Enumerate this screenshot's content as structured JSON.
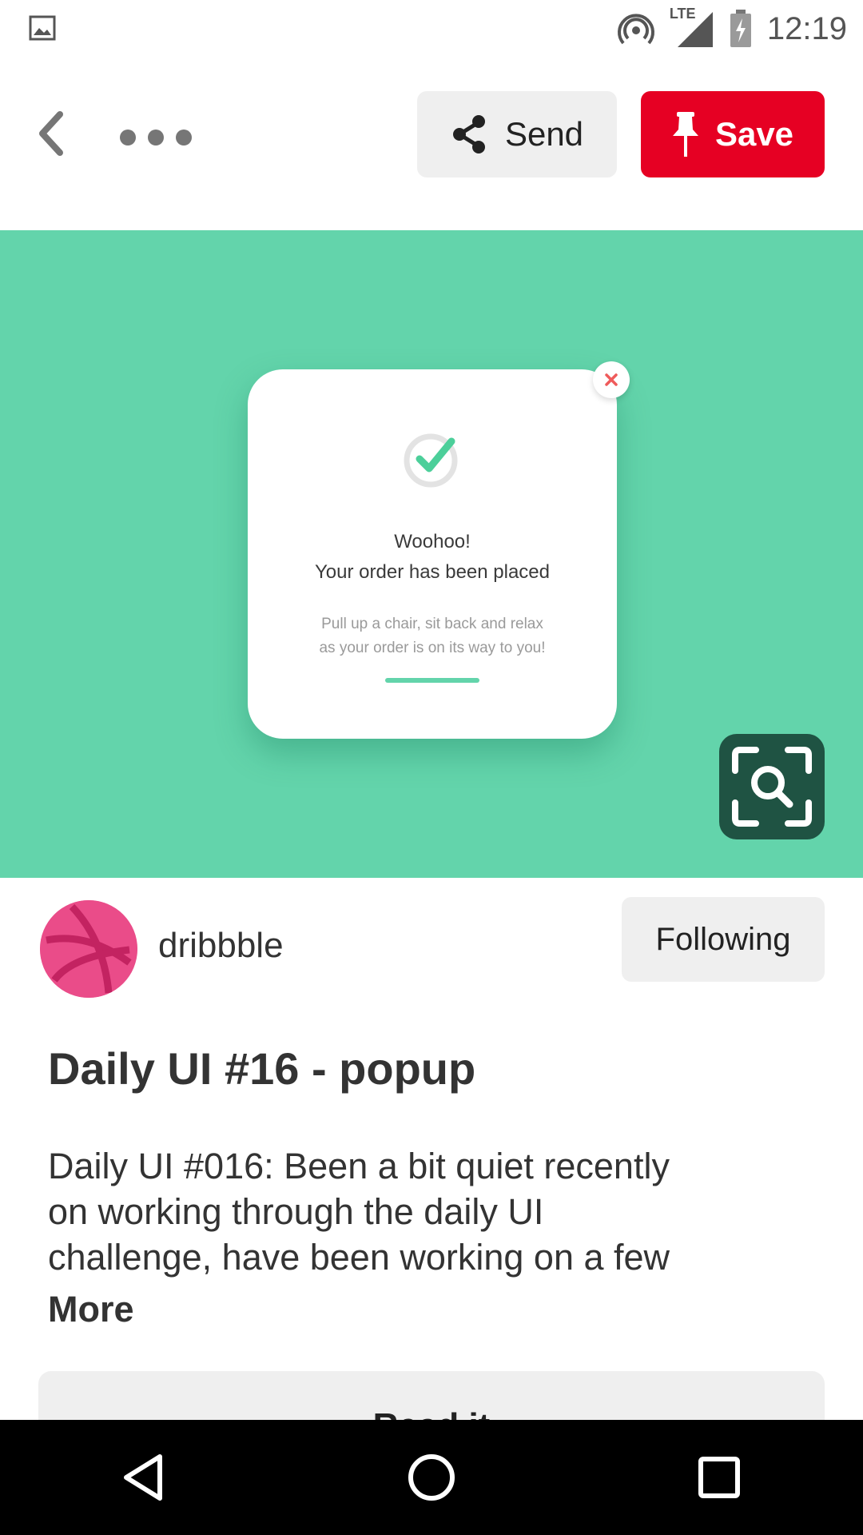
{
  "status_bar": {
    "network": "LTE",
    "time": "12:19"
  },
  "toolbar": {
    "send_label": "Send",
    "save_label": "Save"
  },
  "pin_image": {
    "popup_title_line1": "Woohoo!",
    "popup_title_line2": "Your order has been placed",
    "popup_sub_line1": "Pull up a chair, sit back and relax",
    "popup_sub_line2": "as your order is on its way to you!"
  },
  "creator": {
    "name": "dribbble",
    "follow_label": "Following"
  },
  "pin": {
    "title": "Daily UI #16 - popup",
    "description_lines": [
      "Daily UI #016: Been a bit quiet recently",
      "on working through the daily UI",
      "challenge, have been working on a few"
    ],
    "more_label": "More",
    "read_label": "Read it"
  },
  "colors": {
    "save_red": "#e60023",
    "image_bg": "#63d4ab",
    "lens_bg": "#1f5343",
    "dribbble_pink": "#ea4c89"
  }
}
